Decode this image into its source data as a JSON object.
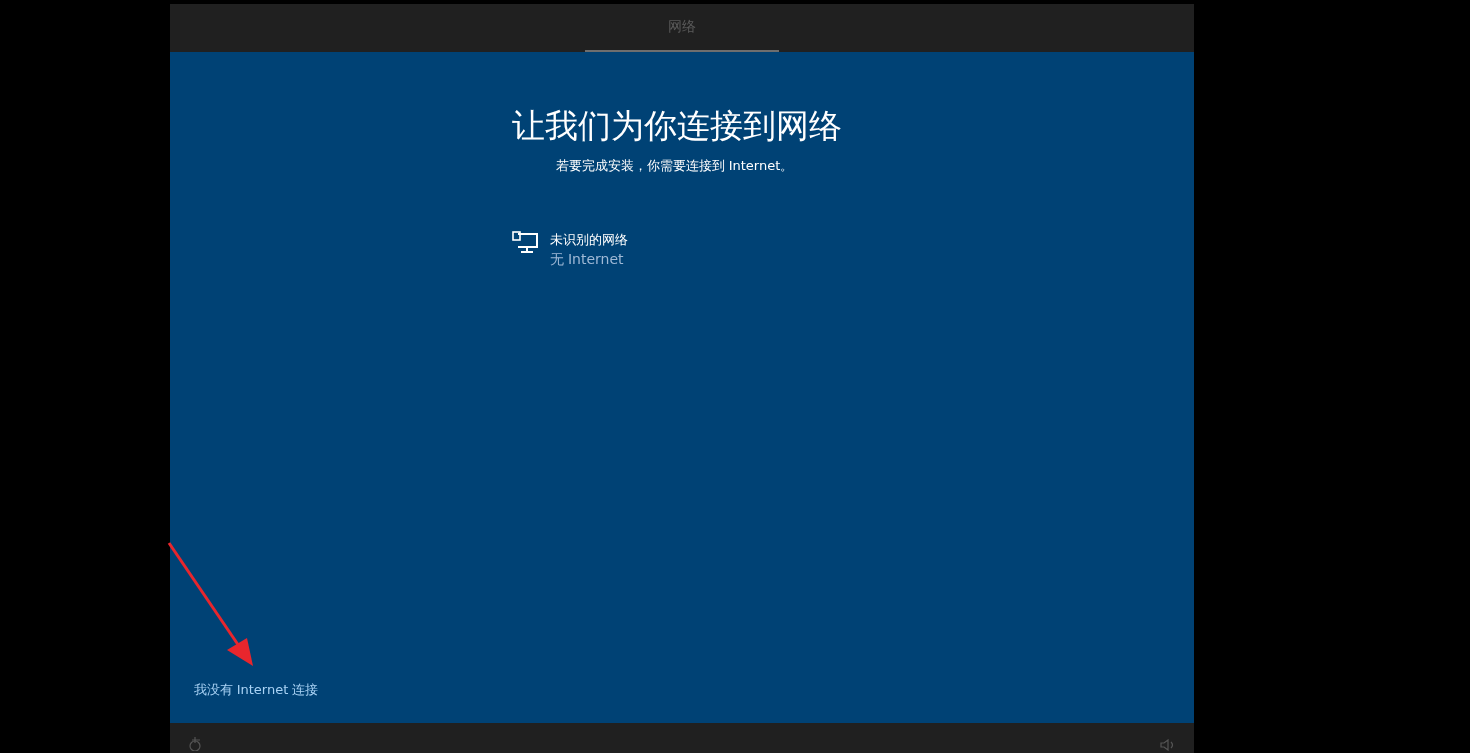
{
  "header": {
    "tabs": [
      {
        "label": "网络",
        "selected": true
      }
    ]
  },
  "main": {
    "title": "让我们为你连接到网络",
    "subtitle": "若要完成安装，你需要连接到 Internet。",
    "networks": [
      {
        "name": "未识别的网络",
        "status": "无 Internet"
      }
    ],
    "skip_link": "我没有 Internet 连接"
  },
  "annotation": {
    "kind": "arrow",
    "color": "#e8262d"
  }
}
